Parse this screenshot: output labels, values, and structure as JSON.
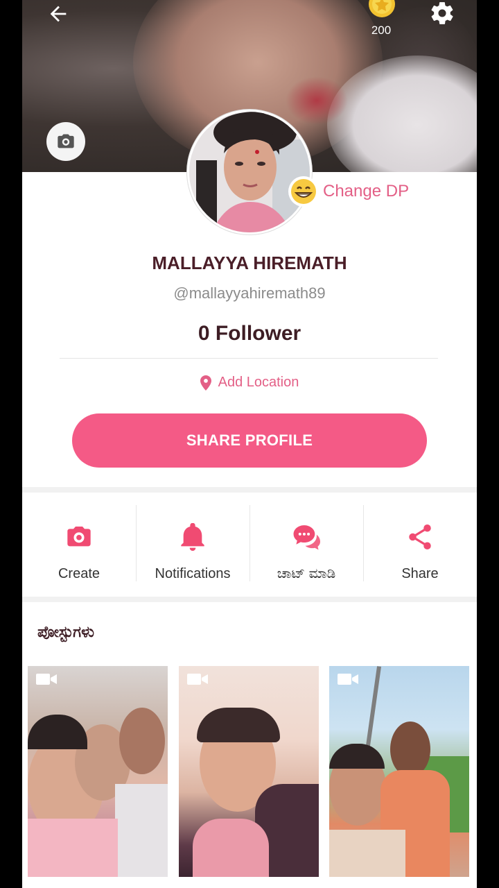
{
  "header": {
    "coin_count": "200"
  },
  "profile": {
    "change_dp_label": "Change DP",
    "name": "MALLAYYA HIREMATH",
    "username": "@mallayyahiremath89",
    "followers": "0 Follower",
    "location_label": "Add Location",
    "share_button": "SHARE PROFILE"
  },
  "actions": [
    {
      "label": "Create",
      "icon": "camera-icon"
    },
    {
      "label": "Notifications",
      "icon": "bell-icon"
    },
    {
      "label": "ಚಾಟ್ ಮಾಡಿ",
      "icon": "chat-icon"
    },
    {
      "label": "Share",
      "icon": "share-icon"
    }
  ],
  "posts": {
    "title": "ಪೋಸ್ಟುಗಳು",
    "items": [
      {
        "type": "video"
      },
      {
        "type": "video"
      },
      {
        "type": "video"
      }
    ]
  },
  "colors": {
    "accent": "#f45a86",
    "accent_text": "#e35f86",
    "name_text": "#4a1e28"
  }
}
